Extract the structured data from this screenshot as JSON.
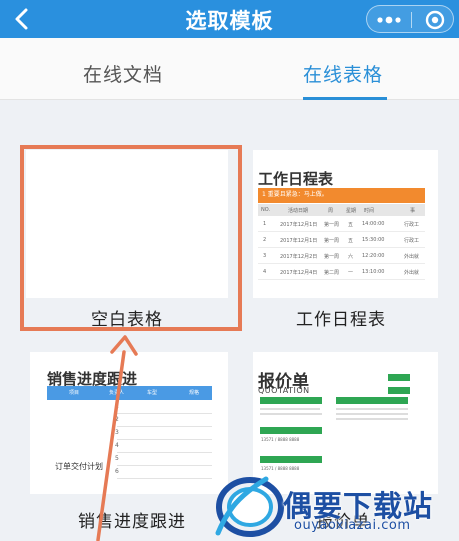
{
  "nav": {
    "title": "选取模板"
  },
  "tabs": [
    {
      "label": "在线文档",
      "active": false
    },
    {
      "label": "在线表格",
      "active": true
    }
  ],
  "templates": {
    "blank": {
      "label": "空白表格",
      "selected": true
    },
    "schedule": {
      "label": "工作日程表",
      "preview_title": "工作日程表",
      "banner": "1 重要且紧急：马上做。",
      "header": [
        "NO.",
        "活动日期",
        "周",
        "星期",
        "时间",
        "事"
      ],
      "rows": [
        [
          "1",
          "2017年12月1日",
          "第一周",
          "五",
          "14:00:00",
          "行政工"
        ],
        [
          "2",
          "2017年12月1日",
          "第一周",
          "五",
          "15:30:00",
          "行政工"
        ],
        [
          "3",
          "2017年12月2日",
          "第一周",
          "六",
          "12:20:00",
          "外出就"
        ],
        [
          "4",
          "2017年12月4日",
          "第二周",
          "一",
          "13:10:00",
          "外出就"
        ]
      ]
    },
    "sales": {
      "label": "销售进度跟进",
      "preview_title": "销售进度跟进",
      "header": [
        "项目",
        "负责人",
        "车型",
        "规格"
      ],
      "numbers": [
        "1",
        "2",
        "3",
        "4",
        "5",
        "6"
      ],
      "plan_label": "订单交付计划"
    },
    "quote": {
      "label": "报价单",
      "preview_title": "报价单",
      "preview_sub": "QUOTATION",
      "phone": "13571 / 8888 8888"
    }
  },
  "watermark": {
    "text": "偶要下载站",
    "url": "ouyaoxiazai.com"
  },
  "colors": {
    "brand": "#2a90de",
    "accent": "#2a8fd7",
    "highlight": "#e67a55",
    "schedule_banner": "#f28a2e",
    "sales_header": "#4a9ae4",
    "quote_green": "#2ea653"
  },
  "icons": {
    "back": "back-chevron-icon",
    "more": "more-dots-icon",
    "close": "close-ring-icon",
    "arrow": "arrow-up-icon",
    "logo": "logo-icon"
  }
}
